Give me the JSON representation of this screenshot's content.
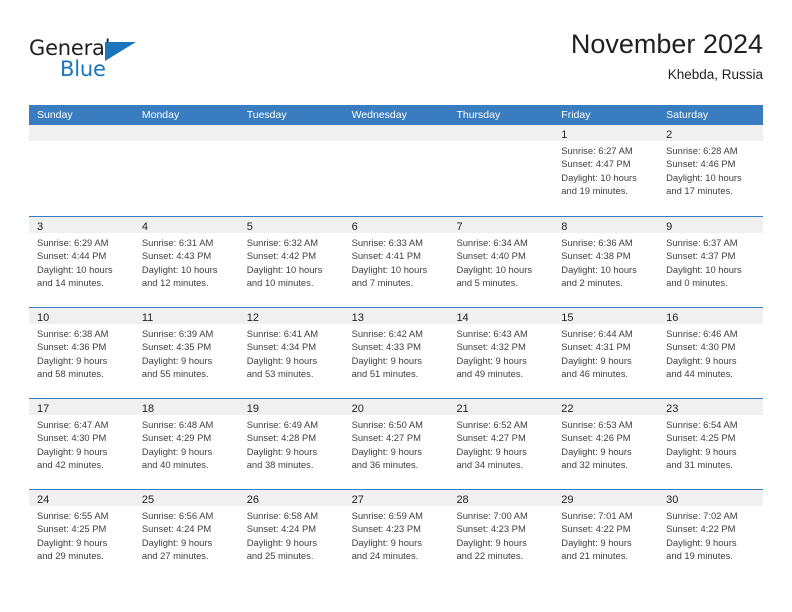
{
  "brand": {
    "name_part1": "General",
    "name_part2": "Blue",
    "accent_color": "#1b75bc",
    "triangle_icon": "brand-triangle-icon"
  },
  "header": {
    "title": "November 2024",
    "subtitle": "Khebda, Russia"
  },
  "theme": {
    "header_row_bg": "#3a7cc0",
    "day_band_bg": "#f0f0f0",
    "text_color": "#231f20",
    "detail_text_color": "#3f3f3f"
  },
  "weekdays": [
    "Sunday",
    "Monday",
    "Tuesday",
    "Wednesday",
    "Thursday",
    "Friday",
    "Saturday"
  ],
  "weeks": [
    [
      {
        "day": "",
        "lines": [
          "",
          "",
          "",
          ""
        ],
        "empty": true
      },
      {
        "day": "",
        "lines": [
          "",
          "",
          "",
          ""
        ],
        "empty": true
      },
      {
        "day": "",
        "lines": [
          "",
          "",
          "",
          ""
        ],
        "empty": true
      },
      {
        "day": "",
        "lines": [
          "",
          "",
          "",
          ""
        ],
        "empty": true
      },
      {
        "day": "",
        "lines": [
          "",
          "",
          "",
          ""
        ],
        "empty": true
      },
      {
        "day": "1",
        "lines": [
          "Sunrise: 6:27 AM",
          "Sunset: 4:47 PM",
          "Daylight: 10 hours",
          "and 19 minutes."
        ],
        "empty": false
      },
      {
        "day": "2",
        "lines": [
          "Sunrise: 6:28 AM",
          "Sunset: 4:46 PM",
          "Daylight: 10 hours",
          "and 17 minutes."
        ],
        "empty": false
      }
    ],
    [
      {
        "day": "3",
        "lines": [
          "Sunrise: 6:29 AM",
          "Sunset: 4:44 PM",
          "Daylight: 10 hours",
          "and 14 minutes."
        ],
        "empty": false
      },
      {
        "day": "4",
        "lines": [
          "Sunrise: 6:31 AM",
          "Sunset: 4:43 PM",
          "Daylight: 10 hours",
          "and 12 minutes."
        ],
        "empty": false
      },
      {
        "day": "5",
        "lines": [
          "Sunrise: 6:32 AM",
          "Sunset: 4:42 PM",
          "Daylight: 10 hours",
          "and 10 minutes."
        ],
        "empty": false
      },
      {
        "day": "6",
        "lines": [
          "Sunrise: 6:33 AM",
          "Sunset: 4:41 PM",
          "Daylight: 10 hours",
          "and 7 minutes."
        ],
        "empty": false
      },
      {
        "day": "7",
        "lines": [
          "Sunrise: 6:34 AM",
          "Sunset: 4:40 PM",
          "Daylight: 10 hours",
          "and 5 minutes."
        ],
        "empty": false
      },
      {
        "day": "8",
        "lines": [
          "Sunrise: 6:36 AM",
          "Sunset: 4:38 PM",
          "Daylight: 10 hours",
          "and 2 minutes."
        ],
        "empty": false
      },
      {
        "day": "9",
        "lines": [
          "Sunrise: 6:37 AM",
          "Sunset: 4:37 PM",
          "Daylight: 10 hours",
          "and 0 minutes."
        ],
        "empty": false
      }
    ],
    [
      {
        "day": "10",
        "lines": [
          "Sunrise: 6:38 AM",
          "Sunset: 4:36 PM",
          "Daylight: 9 hours",
          "and 58 minutes."
        ],
        "empty": false
      },
      {
        "day": "11",
        "lines": [
          "Sunrise: 6:39 AM",
          "Sunset: 4:35 PM",
          "Daylight: 9 hours",
          "and 55 minutes."
        ],
        "empty": false
      },
      {
        "day": "12",
        "lines": [
          "Sunrise: 6:41 AM",
          "Sunset: 4:34 PM",
          "Daylight: 9 hours",
          "and 53 minutes."
        ],
        "empty": false
      },
      {
        "day": "13",
        "lines": [
          "Sunrise: 6:42 AM",
          "Sunset: 4:33 PM",
          "Daylight: 9 hours",
          "and 51 minutes."
        ],
        "empty": false
      },
      {
        "day": "14",
        "lines": [
          "Sunrise: 6:43 AM",
          "Sunset: 4:32 PM",
          "Daylight: 9 hours",
          "and 49 minutes."
        ],
        "empty": false
      },
      {
        "day": "15",
        "lines": [
          "Sunrise: 6:44 AM",
          "Sunset: 4:31 PM",
          "Daylight: 9 hours",
          "and 46 minutes."
        ],
        "empty": false
      },
      {
        "day": "16",
        "lines": [
          "Sunrise: 6:46 AM",
          "Sunset: 4:30 PM",
          "Daylight: 9 hours",
          "and 44 minutes."
        ],
        "empty": false
      }
    ],
    [
      {
        "day": "17",
        "lines": [
          "Sunrise: 6:47 AM",
          "Sunset: 4:30 PM",
          "Daylight: 9 hours",
          "and 42 minutes."
        ],
        "empty": false
      },
      {
        "day": "18",
        "lines": [
          "Sunrise: 6:48 AM",
          "Sunset: 4:29 PM",
          "Daylight: 9 hours",
          "and 40 minutes."
        ],
        "empty": false
      },
      {
        "day": "19",
        "lines": [
          "Sunrise: 6:49 AM",
          "Sunset: 4:28 PM",
          "Daylight: 9 hours",
          "and 38 minutes."
        ],
        "empty": false
      },
      {
        "day": "20",
        "lines": [
          "Sunrise: 6:50 AM",
          "Sunset: 4:27 PM",
          "Daylight: 9 hours",
          "and 36 minutes."
        ],
        "empty": false
      },
      {
        "day": "21",
        "lines": [
          "Sunrise: 6:52 AM",
          "Sunset: 4:27 PM",
          "Daylight: 9 hours",
          "and 34 minutes."
        ],
        "empty": false
      },
      {
        "day": "22",
        "lines": [
          "Sunrise: 6:53 AM",
          "Sunset: 4:26 PM",
          "Daylight: 9 hours",
          "and 32 minutes."
        ],
        "empty": false
      },
      {
        "day": "23",
        "lines": [
          "Sunrise: 6:54 AM",
          "Sunset: 4:25 PM",
          "Daylight: 9 hours",
          "and 31 minutes."
        ],
        "empty": false
      }
    ],
    [
      {
        "day": "24",
        "lines": [
          "Sunrise: 6:55 AM",
          "Sunset: 4:25 PM",
          "Daylight: 9 hours",
          "and 29 minutes."
        ],
        "empty": false
      },
      {
        "day": "25",
        "lines": [
          "Sunrise: 6:56 AM",
          "Sunset: 4:24 PM",
          "Daylight: 9 hours",
          "and 27 minutes."
        ],
        "empty": false
      },
      {
        "day": "26",
        "lines": [
          "Sunrise: 6:58 AM",
          "Sunset: 4:24 PM",
          "Daylight: 9 hours",
          "and 25 minutes."
        ],
        "empty": false
      },
      {
        "day": "27",
        "lines": [
          "Sunrise: 6:59 AM",
          "Sunset: 4:23 PM",
          "Daylight: 9 hours",
          "and 24 minutes."
        ],
        "empty": false
      },
      {
        "day": "28",
        "lines": [
          "Sunrise: 7:00 AM",
          "Sunset: 4:23 PM",
          "Daylight: 9 hours",
          "and 22 minutes."
        ],
        "empty": false
      },
      {
        "day": "29",
        "lines": [
          "Sunrise: 7:01 AM",
          "Sunset: 4:22 PM",
          "Daylight: 9 hours",
          "and 21 minutes."
        ],
        "empty": false
      },
      {
        "day": "30",
        "lines": [
          "Sunrise: 7:02 AM",
          "Sunset: 4:22 PM",
          "Daylight: 9 hours",
          "and 19 minutes."
        ],
        "empty": false
      }
    ]
  ]
}
